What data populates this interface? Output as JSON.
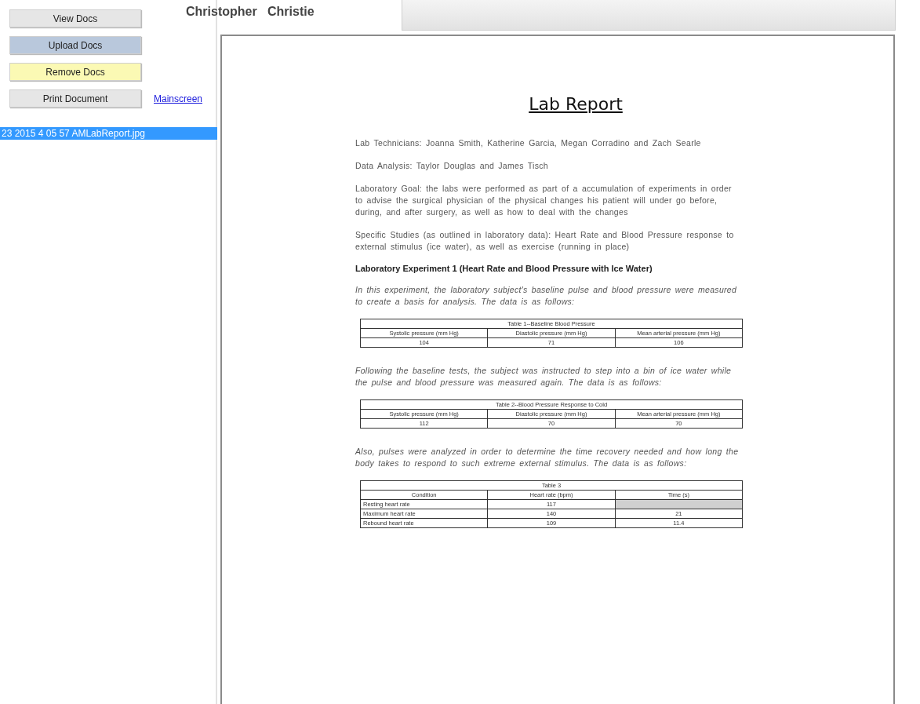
{
  "buttons": [
    {
      "label": "View Docs",
      "color": "#e6e6e6"
    },
    {
      "label": "Upload Docs",
      "color": "#b9c8dc"
    },
    {
      "label": "Remove Docs",
      "color": "#fbf9b4"
    },
    {
      "label": "Print Document",
      "color": "#e6e6e6"
    }
  ],
  "mainscreen_link": "Mainscreen",
  "patient_name": "Christopher   Christie",
  "documents": [
    {
      "name": "23 2015 4 05 57 AMLabReport.jpg",
      "selected": true
    }
  ],
  "document": {
    "title": "Lab Report",
    "blocks": [
      {
        "kind": "paragraph",
        "text": "Lab Technicians: Joanna Smith, Katherine Garcia, Megan Corradino and Zach Searle"
      },
      {
        "kind": "paragraph",
        "text": "Data Analysis: Taylor Douglas and James Tisch"
      },
      {
        "kind": "paragraph",
        "text": "Laboratory Goal: the labs were performed as part of a accumulation of experiments in order to advise the surgical physician of the physical changes his patient will under go before, during, and after surgery, as well as how to deal with the changes"
      },
      {
        "kind": "paragraph",
        "text": "Specific Studies (as outlined in laboratory data): Heart Rate and Blood Pressure response to external stimulus (ice water), as well as exercise (running in place)"
      },
      {
        "kind": "heading",
        "text": "Laboratory Experiment 1 (Heart Rate and Blood Pressure with Ice Water)"
      },
      {
        "kind": "note",
        "text": "In this experiment, the laboratory subject's baseline pulse and blood pressure were measured to create a basis for analysis. The data is as follows:"
      },
      {
        "kind": "table",
        "caption": "Table 1--Baseline Blood Pressure",
        "header": [
          "Systolic pressure (mm Hg)",
          "Diastolic pressure (mm Hg)",
          "Mean arterial pressure (mm Hg)"
        ],
        "rows": [
          [
            {
              "text": "104"
            },
            {
              "text": "71"
            },
            {
              "text": "106"
            }
          ]
        ]
      },
      {
        "kind": "note",
        "text": "Following the baseline tests, the subject was instructed to step into a bin of ice water while the pulse and blood pressure was measured again. The data is as follows:"
      },
      {
        "kind": "table",
        "caption": "Table 2--Blood Pressure Response to Cold",
        "header": [
          "Systolic pressure (mm Hg)",
          "Diastolic pressure (mm Hg)",
          "Mean arterial pressure (mm Hg)"
        ],
        "rows": [
          [
            {
              "text": "112"
            },
            {
              "text": "70"
            },
            {
              "text": "70"
            }
          ]
        ]
      },
      {
        "kind": "note",
        "text": "Also, pulses were analyzed in order to determine the time recovery needed and how long the body takes to respond to such extreme external stimulus. The data is as follows:"
      },
      {
        "kind": "table",
        "caption": "Table 3",
        "header": [
          "Condition",
          "Heart rate (bpm)",
          "Time (s)"
        ],
        "rows": [
          [
            {
              "text": "Resting heart rate",
              "kind": "label"
            },
            {
              "text": "117"
            },
            {
              "shaded": true
            }
          ],
          [
            {
              "text": "Maximum heart rate",
              "kind": "label"
            },
            {
              "text": "140"
            },
            {
              "text": "21"
            }
          ],
          [
            {
              "text": "Rebound heart rate",
              "kind": "label"
            },
            {
              "text": "109"
            },
            {
              "text": "11.4"
            }
          ]
        ]
      }
    ]
  }
}
